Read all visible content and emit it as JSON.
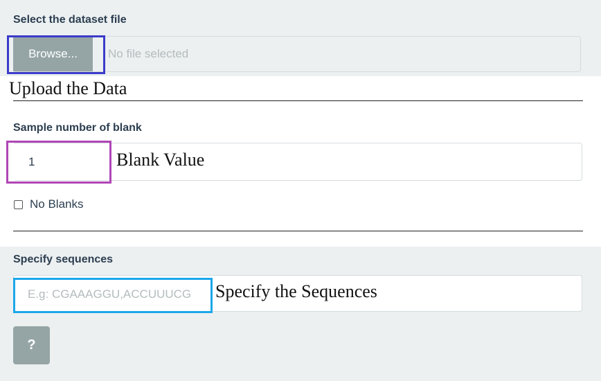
{
  "file_upload": {
    "label": "Select the dataset file",
    "browse_label": "Browse...",
    "status": "No file selected",
    "annotation": "Upload the Data"
  },
  "blank": {
    "label": "Sample number of blank",
    "value": "1",
    "annotation": "Blank Value",
    "no_blanks_label": "No Blanks",
    "no_blanks_checked": false
  },
  "sequences": {
    "label": "Specify sequences",
    "placeholder": "E.g: CGAAAGGU,ACCUUUCG",
    "value": "",
    "annotation": "Specify the Sequences"
  },
  "help": {
    "label": "?"
  },
  "colors": {
    "upload_highlight": "#3b3bc9",
    "blank_highlight": "#b045b6",
    "sequence_highlight": "#1aa7ea",
    "button_bg": "#95a5a6"
  }
}
